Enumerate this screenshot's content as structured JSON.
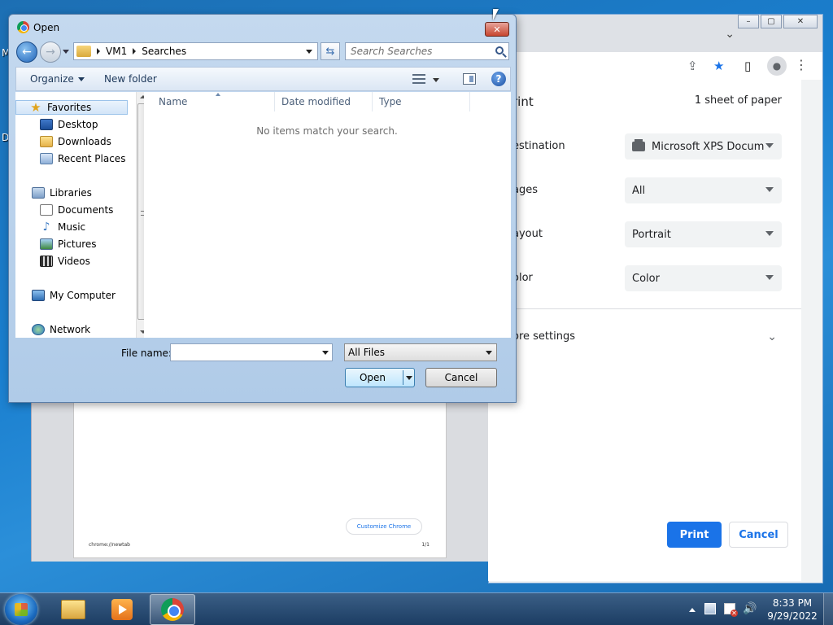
{
  "desktop": {
    "edge_letters": [
      "M",
      "D"
    ]
  },
  "chrome": {
    "print_panel": {
      "title": "rint",
      "sheets": "1 sheet of paper",
      "rows": [
        {
          "label": "estination",
          "value": "Microsoft XPS Docum"
        },
        {
          "label": "ages",
          "value": "All"
        },
        {
          "label": "ayout",
          "value": "Portrait"
        },
        {
          "label": "olor",
          "value": "Color"
        }
      ],
      "more_settings": "ore settings",
      "print_button": "Print",
      "cancel_button": "Cancel"
    },
    "preview": {
      "customize_label": "Customize Chrome",
      "footer_left": "chrome://newtab",
      "footer_right": "1/1"
    }
  },
  "dialog": {
    "title": "Open",
    "close_glyph": "✕",
    "breadcrumb": [
      "VM1",
      "Searches"
    ],
    "search_placeholder": "Search Searches",
    "toolbar": {
      "organize": "Organize",
      "new_folder": "New folder"
    },
    "nav": {
      "favorites_header": "Favorites",
      "favorites": [
        "Desktop",
        "Downloads",
        "Recent Places"
      ],
      "libraries_header": "Libraries",
      "libraries": [
        "Documents",
        "Music",
        "Pictures",
        "Videos"
      ],
      "computer": "My Computer",
      "network": "Network"
    },
    "columns": [
      "Name",
      "Date modified",
      "Type"
    ],
    "empty_message": "No items match your search.",
    "file_name_label": "File name:",
    "file_name_value": "",
    "filter_value": "All Files",
    "open_button": "Open",
    "cancel_button": "Cancel"
  },
  "taskbar": {
    "time": "8:33 PM",
    "date": "9/29/2022"
  }
}
